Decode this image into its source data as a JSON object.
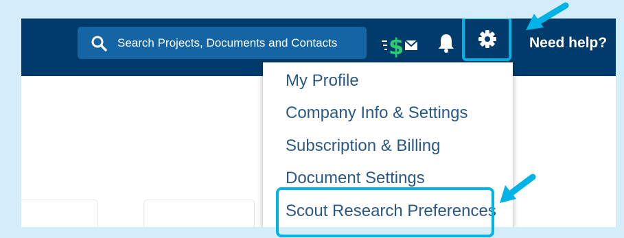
{
  "search": {
    "placeholder": "Search Projects, Documents and Contacts"
  },
  "header": {
    "help_label": "Need help?"
  },
  "menu": {
    "items": [
      {
        "label": "My Profile"
      },
      {
        "label": "Company Info & Settings"
      },
      {
        "label": "Subscription & Billing"
      },
      {
        "label": "Document Settings"
      },
      {
        "label": "Scout Research Preferences"
      }
    ]
  },
  "colors": {
    "header_bg": "#003b6c",
    "search_bg": "#1565a5",
    "accent": "#00b3e6",
    "menu_text": "#2b5986",
    "dollar_green": "#2ecc71"
  },
  "icons": [
    "search-icon",
    "dollar-envelope-icon",
    "bell-icon",
    "gear-icon",
    "arrow-icon"
  ]
}
